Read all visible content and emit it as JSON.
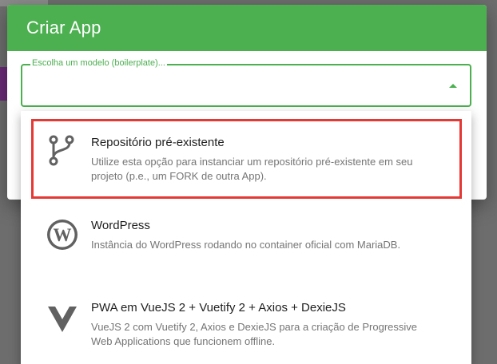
{
  "dialog": {
    "title": "Criar App",
    "select": {
      "label": "Escolha um modelo (boilerplate)...",
      "value": ""
    }
  },
  "menu": {
    "items": [
      {
        "title": "Repositório pré-existente",
        "description": "Utilize esta opção para instanciar um repositório pré-existente em seu projeto (p.e., um FORK de outra App).",
        "icon": "source-branch-icon"
      },
      {
        "title": "WordPress",
        "description": "Instância do WordPress rodando no container oficial com MariaDB.",
        "icon": "wordpress-icon"
      },
      {
        "title": "PWA em VueJS 2 + Vuetify 2 + Axios + DexieJS",
        "description": "VueJS 2 com Vuetify 2, Axios e DexieJS para a criação de Progressive Web Applications que funcionem offline.",
        "icon": "vuetify-icon"
      }
    ]
  },
  "colors": {
    "accent": "#4caf50",
    "highlight": "#e53935",
    "icon": "#616161"
  }
}
